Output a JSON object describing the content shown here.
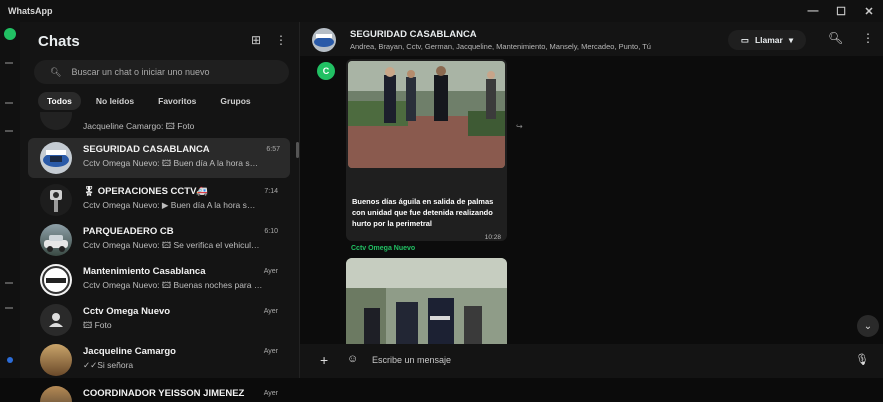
{
  "window": {
    "title": "WhatsApp",
    "controls": [
      "—",
      "☐",
      "✕"
    ]
  },
  "sidebar": {
    "title": "Chats",
    "search_placeholder": "Buscar un chat o iniciar uno nuevo",
    "filters": [
      "Todos",
      "No leídos",
      "Favoritos",
      "Grupos"
    ],
    "active_filter": "Todos",
    "chats": [
      {
        "name": "",
        "preview": "Jacqueline Camargo: 🖾 Foto",
        "time": ""
      },
      {
        "name": "SEGURIDAD CASABLANCA",
        "preview": "Cctv Omega Nuevo: 🖾 Buen día  A la hora s…",
        "time": "6:57",
        "selected": true
      },
      {
        "name": "🎖 OPERACIONES CCTV🚑",
        "preview": "Cctv Omega Nuevo: ▶ Buen día  A la hora s…",
        "time": "7:14"
      },
      {
        "name": "PARQUEADERO CB",
        "preview": "Cctv Omega Nuevo: 🖾 Se verifica el vehicul…",
        "time": "6:10"
      },
      {
        "name": "Mantenimiento Casablanca",
        "preview": "Cctv Omega Nuevo: 🖾 Buenas noches para …",
        "time": "Ayer"
      },
      {
        "name": "Cctv Omega Nuevo",
        "preview": "🖾 Foto",
        "time": "Ayer"
      },
      {
        "name": "Jacqueline Camargo",
        "preview": "✓✓Si señora",
        "time": "Ayer"
      },
      {
        "name": "COORDINADOR YEISSON JIMENEZ",
        "preview": "",
        "time": "Ayer"
      }
    ]
  },
  "conversation": {
    "group_name": "SEGURIDAD CASABLANCA",
    "members": "Andrea, Brayan, Cctv, German, Jacqueline, Mantenimiento, Mansely, Mercadeo, Punto, Tú",
    "call_label": "Llamar",
    "sender_initial": "C",
    "message_text": "Buenos días águila  en salida de palmas con unidad que fue detenida realizando hurto por la perimetral",
    "message_time": "10:28",
    "second_sender": "Cctv Omega Nuevo",
    "composer_placeholder": "Escribe un mensaje"
  },
  "colors": {
    "accent": "#21c063",
    "background": "#0c0c0c",
    "panel": "#141414"
  }
}
